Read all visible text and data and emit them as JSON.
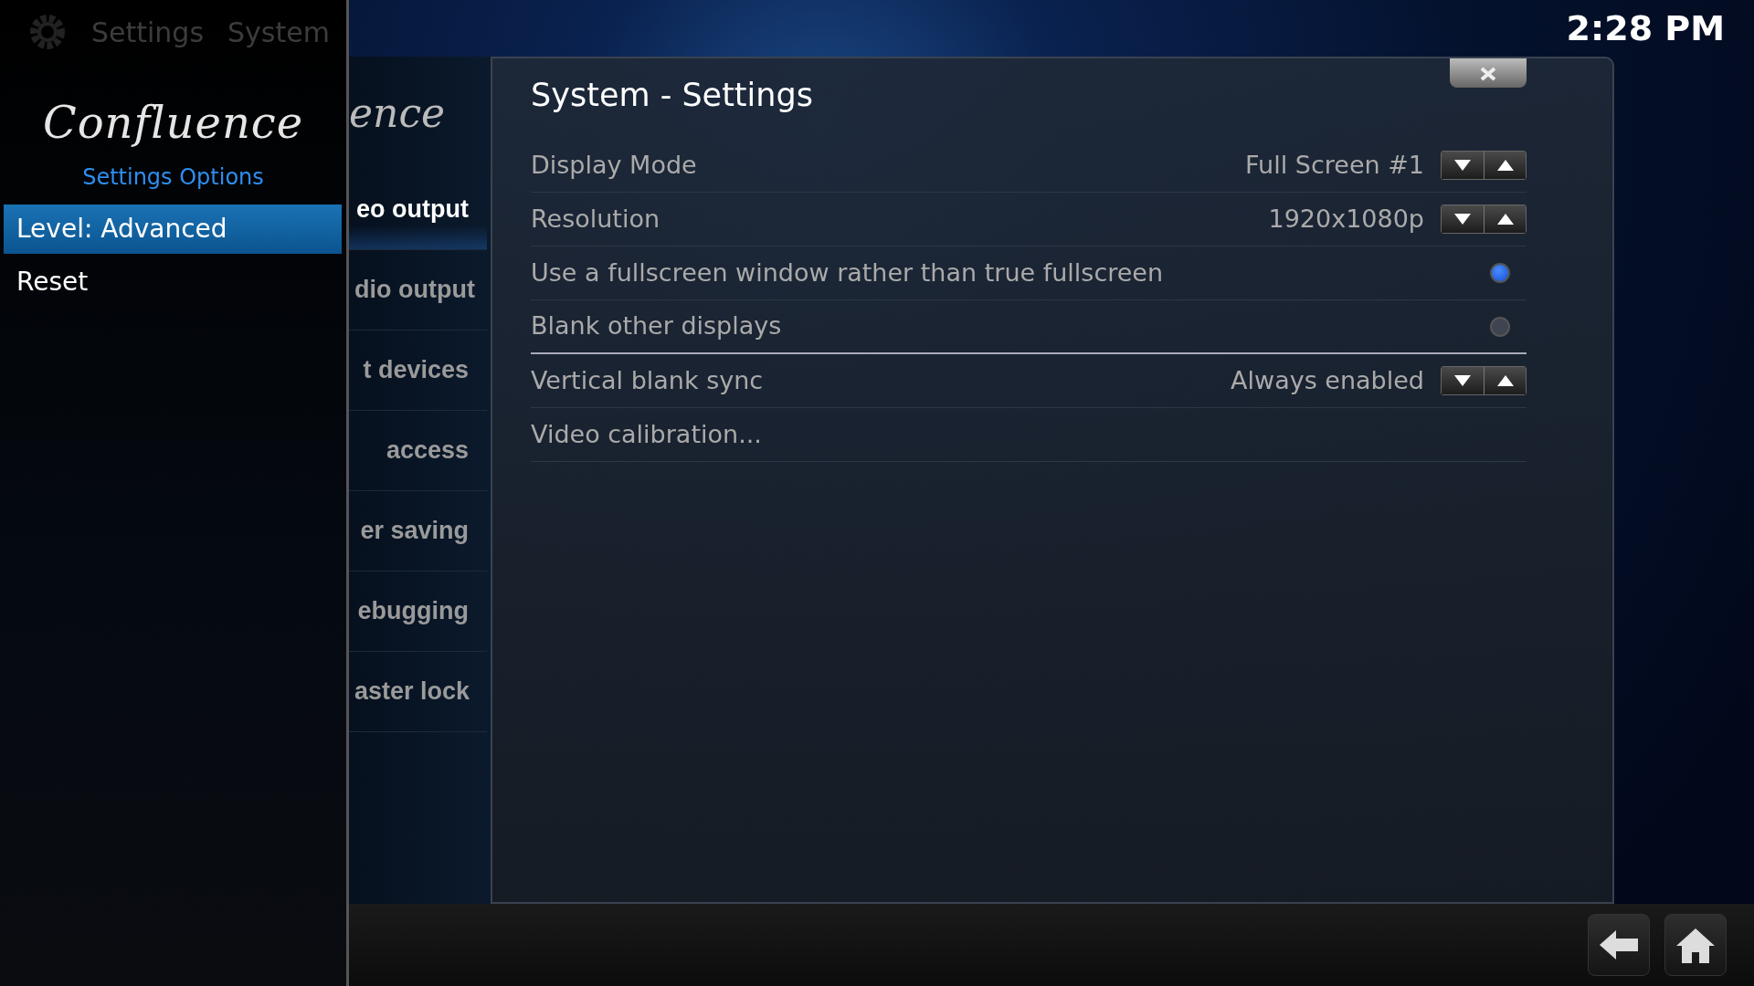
{
  "header": {
    "breadcrumb": [
      "Settings",
      "System"
    ],
    "clock": "2:28 PM"
  },
  "side_panel": {
    "logo": "Confluence",
    "title": "Settings Options",
    "items": [
      {
        "label": "Level: Advanced",
        "selected": true
      },
      {
        "label": "Reset",
        "selected": false
      }
    ]
  },
  "background_logo": "ence",
  "categories": [
    {
      "label": "eo output",
      "selected": true
    },
    {
      "label": "dio output",
      "selected": false
    },
    {
      "label": "t devices",
      "selected": false
    },
    {
      "label": "access",
      "selected": false
    },
    {
      "label": "er saving",
      "selected": false
    },
    {
      "label": "ebugging",
      "selected": false
    },
    {
      "label": "aster lock",
      "selected": false
    }
  ],
  "dialog": {
    "title": "System - Settings",
    "settings": [
      {
        "kind": "spinner",
        "label": "Display Mode",
        "value": "Full Screen #1"
      },
      {
        "kind": "spinner",
        "label": "Resolution",
        "value": "1920x1080p"
      },
      {
        "kind": "radio",
        "label": "Use a fullscreen window rather than true fullscreen",
        "on": true
      },
      {
        "kind": "radio",
        "label": "Blank other displays",
        "on": false
      },
      {
        "kind": "spinner",
        "label": "Vertical blank sync",
        "value": "Always enabled"
      },
      {
        "kind": "button",
        "label": "Video calibration..."
      }
    ]
  }
}
